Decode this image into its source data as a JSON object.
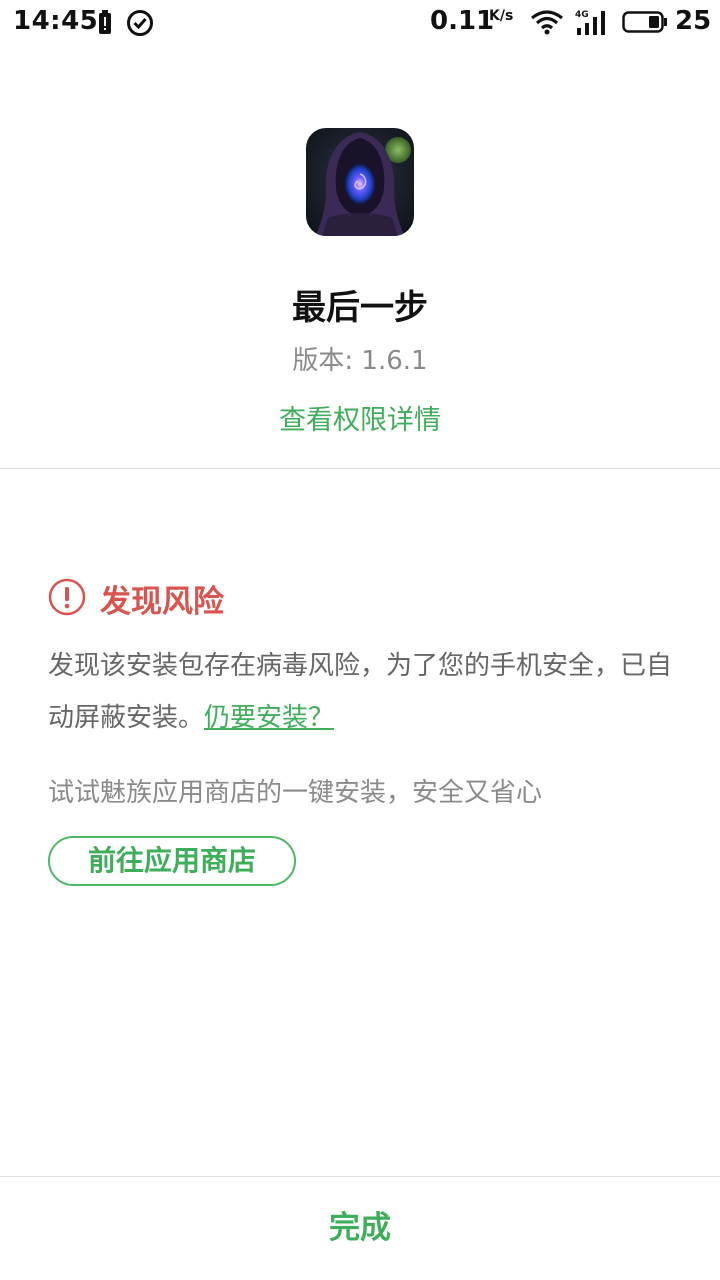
{
  "status_bar": {
    "time": "14:45",
    "net_speed": "0.11",
    "net_speed_unit": "K/s",
    "network_type": "4G",
    "battery_level": "25",
    "icons": [
      "battery-alert-icon",
      "check-circle-icon",
      "wifi-icon",
      "cell-signal-icon",
      "battery-icon"
    ]
  },
  "app": {
    "icon": "hooded-figure-game-icon",
    "name": "最后一步",
    "version": "版本: 1.6.1",
    "permissions_link": "查看权限详情"
  },
  "risk": {
    "icon": "warning-circle-icon",
    "title": "发现风险",
    "body_text": "发现该安装包存在病毒风险，为了您的手机安全，已自动屏蔽安装。",
    "still_install_link": "仍要安装？",
    "store_hint": "试试魅族应用商店的一键安装，安全又省心",
    "store_button": "前往应用商店"
  },
  "footer": {
    "done_button": "完成"
  },
  "colors": {
    "accent_green": "#3fae5a",
    "risk_red": "#d9534f",
    "body_gray": "#666666",
    "hint_gray": "#8a8a8a"
  }
}
